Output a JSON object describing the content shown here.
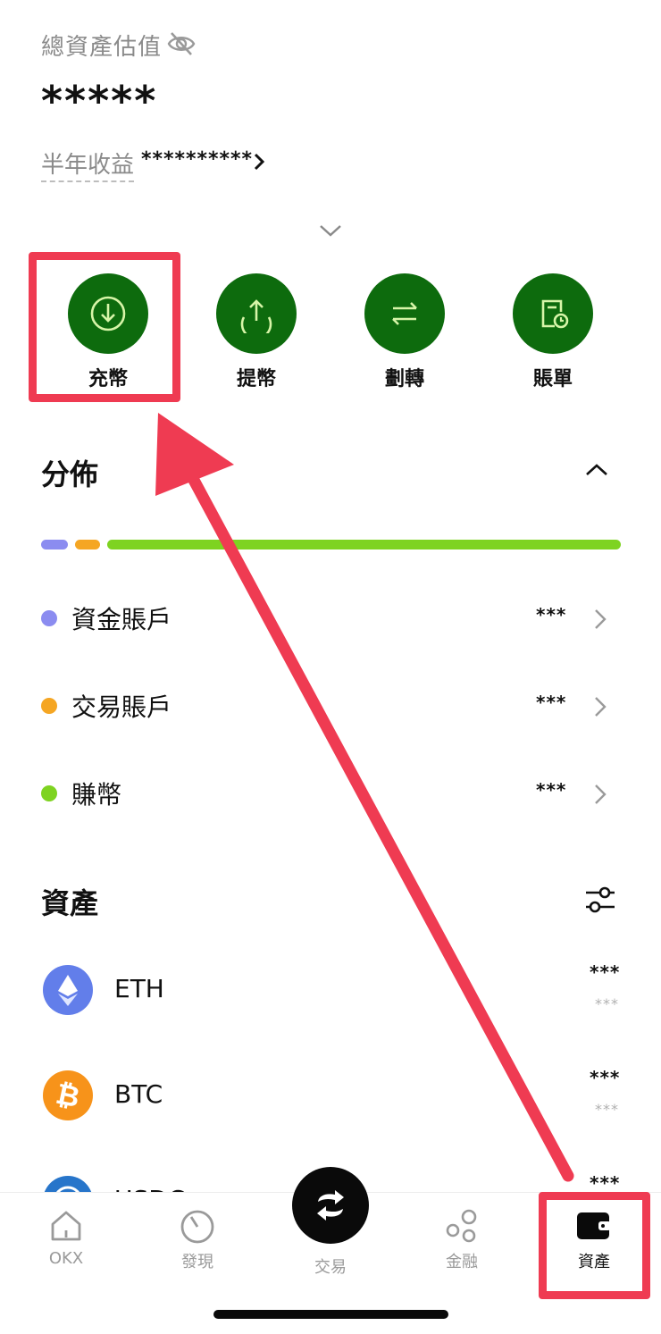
{
  "header": {
    "estimate_label": "總資產估值",
    "balance": "*****",
    "pnl_label": "半年收益",
    "pnl_value": "**********"
  },
  "actions": [
    {
      "label": "充幣",
      "icon": "deposit-icon"
    },
    {
      "label": "提幣",
      "icon": "withdraw-icon"
    },
    {
      "label": "劃轉",
      "icon": "transfer-icon"
    },
    {
      "label": "賬單",
      "icon": "bill-icon"
    }
  ],
  "distribution": {
    "title": "分佈",
    "segments": [
      {
        "color": "#8b8cf0",
        "share": 0.05
      },
      {
        "color": "#f5a623",
        "share": 0.05
      },
      {
        "color": "#7ed321",
        "share": 0.9
      }
    ],
    "accounts": [
      {
        "name": "資金賬戶",
        "value": "***",
        "color": "#8b8cf0"
      },
      {
        "name": "交易賬戶",
        "value": "***",
        "color": "#f5a623"
      },
      {
        "name": "賺幣",
        "value": "***",
        "color": "#7ed321"
      }
    ]
  },
  "assets": {
    "title": "資產",
    "items": [
      {
        "symbol": "ETH",
        "value": "***",
        "sub_value": "***",
        "color": "#627eea"
      },
      {
        "symbol": "BTC",
        "value": "***",
        "sub_value": "***",
        "color": "#f7931a"
      },
      {
        "symbol": "USDC",
        "value": "***",
        "color": "#2775ca"
      }
    ]
  },
  "bottom_nav": {
    "okx": "OKX",
    "discover": "發現",
    "trade": "交易",
    "finance": "金融",
    "assets": "資產"
  },
  "colors": {
    "action_green": "#0d6b0d",
    "highlight_red": "#ef3b52"
  }
}
